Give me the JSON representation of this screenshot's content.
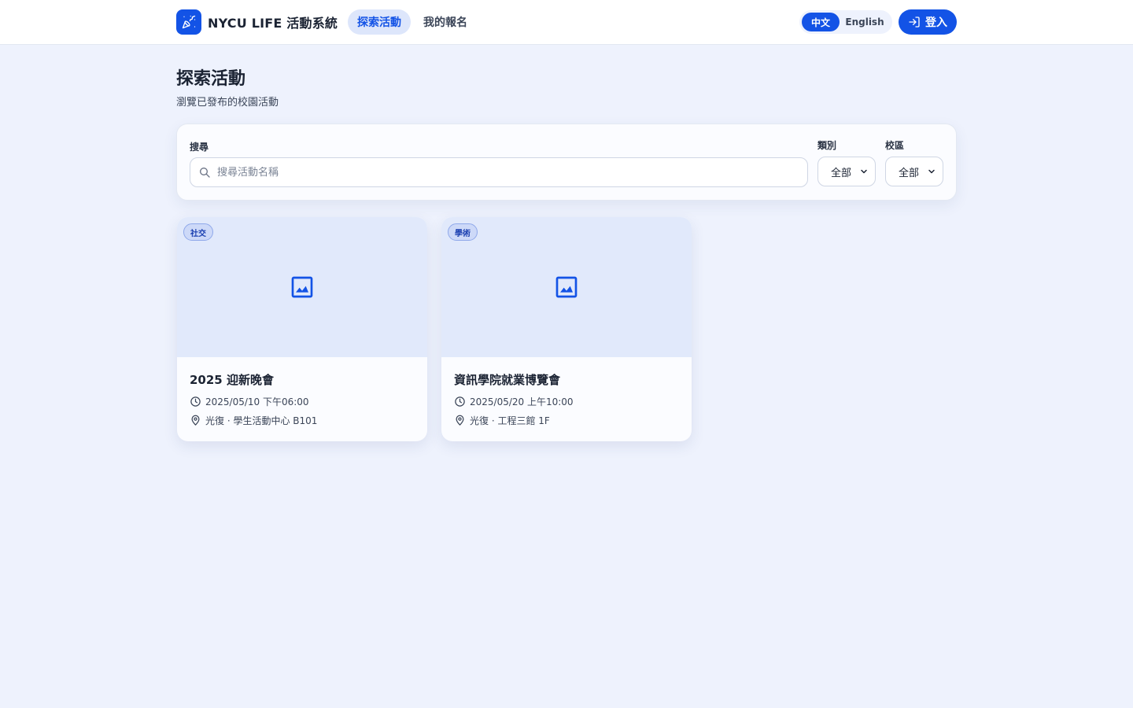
{
  "header": {
    "app_name": "NYCU LIFE 活動系統",
    "nav": [
      {
        "label": "探索活動",
        "active": true
      },
      {
        "label": "我的報名",
        "active": false
      }
    ],
    "language": {
      "options": [
        "中文",
        "English"
      ],
      "selected": "中文"
    },
    "login_label": "登入"
  },
  "page": {
    "title": "探索活動",
    "subtitle": "瀏覽已發布的校園活動"
  },
  "filters": {
    "search_label": "搜尋",
    "search_placeholder": "搜尋活動名稱",
    "search_value": "",
    "category_label": "類別",
    "category_value": "全部",
    "campus_label": "校區",
    "campus_value": "全部"
  },
  "events": [
    {
      "category": "社交",
      "title": "2025 迎新晚會",
      "datetime": "2025/05/10 下午06:00",
      "location": "光復 · 學生活動中心 B101"
    },
    {
      "category": "學術",
      "title": "資訊學院就業博覽會",
      "datetime": "2025/05/20 上午10:00",
      "location": "光復 · 工程三館 1F"
    }
  ],
  "colors": {
    "accent": "#1353e6",
    "background": "#eef2fd",
    "image_placeholder": "#e1e9fb"
  },
  "icons": [
    "party-popper-icon",
    "login-icon",
    "search-icon",
    "chevron-down-icon",
    "image-icon",
    "clock-icon",
    "map-pin-icon"
  ]
}
